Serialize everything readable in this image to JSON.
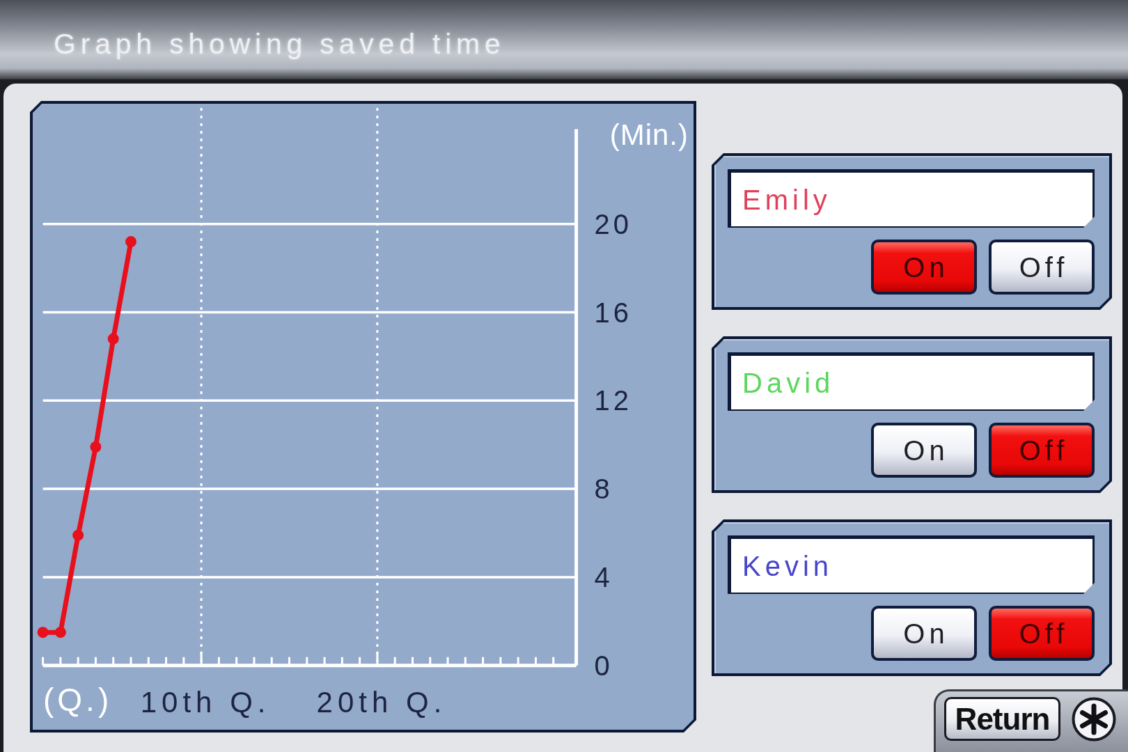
{
  "title": "Graph showing saved time",
  "chart": {
    "chart_data": {
      "type": "line",
      "xlabel": "(Q.)",
      "ylabel": "(Min.)",
      "x": [
        1,
        2,
        3,
        4,
        5,
        6
      ],
      "xlim": [
        1,
        31.3
      ],
      "ylim": [
        0,
        24.3
      ],
      "xticks": [
        {
          "value": 10,
          "label": "10th Q."
        },
        {
          "value": 20,
          "label": "20th Q."
        }
      ],
      "yticks": [
        0,
        4,
        8,
        12,
        16,
        20
      ],
      "grid": true,
      "series": [
        {
          "color": "#e8101c",
          "marker": "o",
          "values": [
            1.5,
            1.5,
            5.9,
            9.9,
            14.8,
            19.2
          ]
        }
      ]
    }
  },
  "players": [
    {
      "name": "Emily",
      "color": "#e0405a",
      "options": [
        {
          "label": "On",
          "selected": true
        },
        {
          "label": "Off",
          "selected": false
        }
      ]
    },
    {
      "name": "David",
      "color": "#5cd65c",
      "options": [
        {
          "label": "On",
          "selected": false
        },
        {
          "label": "Off",
          "selected": true
        }
      ]
    },
    {
      "name": "Kevin",
      "color": "#4646cc",
      "options": [
        {
          "label": "On",
          "selected": false
        },
        {
          "label": "Off",
          "selected": true
        }
      ]
    }
  ],
  "return_button": {
    "label": "Return"
  }
}
